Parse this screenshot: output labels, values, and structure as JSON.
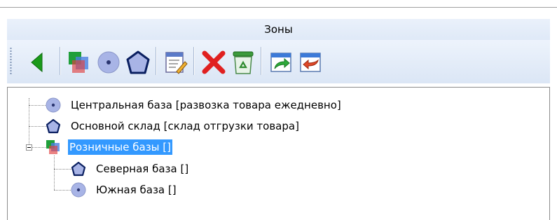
{
  "panel": {
    "title": "Зоны"
  },
  "toolbar": {
    "buttons": [
      {
        "name": "back-arrow-icon"
      },
      {
        "name": "zone-group-icon"
      },
      {
        "name": "circle-zone-icon"
      },
      {
        "name": "polygon-zone-icon"
      },
      {
        "name": "edit-properties-icon"
      },
      {
        "name": "delete-icon"
      },
      {
        "name": "recycle-bin-icon"
      },
      {
        "name": "export-icon"
      },
      {
        "name": "import-icon"
      }
    ]
  },
  "tree": {
    "nodes": [
      {
        "label": "Центральная база [развозка товара ежедневно]",
        "icon": "circle-zone-icon",
        "level": 0
      },
      {
        "label": "Основной склад [склад отгрузки товара]",
        "icon": "polygon-zone-icon",
        "level": 0
      },
      {
        "label": "Розничные базы []",
        "icon": "zone-group-icon",
        "level": 0,
        "expanded": true,
        "selected": true
      },
      {
        "label": "Северная база []",
        "icon": "polygon-zone-icon",
        "level": 1
      },
      {
        "label": "Южная база []",
        "icon": "circle-zone-icon",
        "level": 1
      }
    ]
  },
  "colors": {
    "selection": "#3399ff",
    "toolbar_bg": "#dfe9f7",
    "zone_icon": "#a8b4e6",
    "delete_red": "#e02020",
    "back_green": "#1a9a1a"
  }
}
